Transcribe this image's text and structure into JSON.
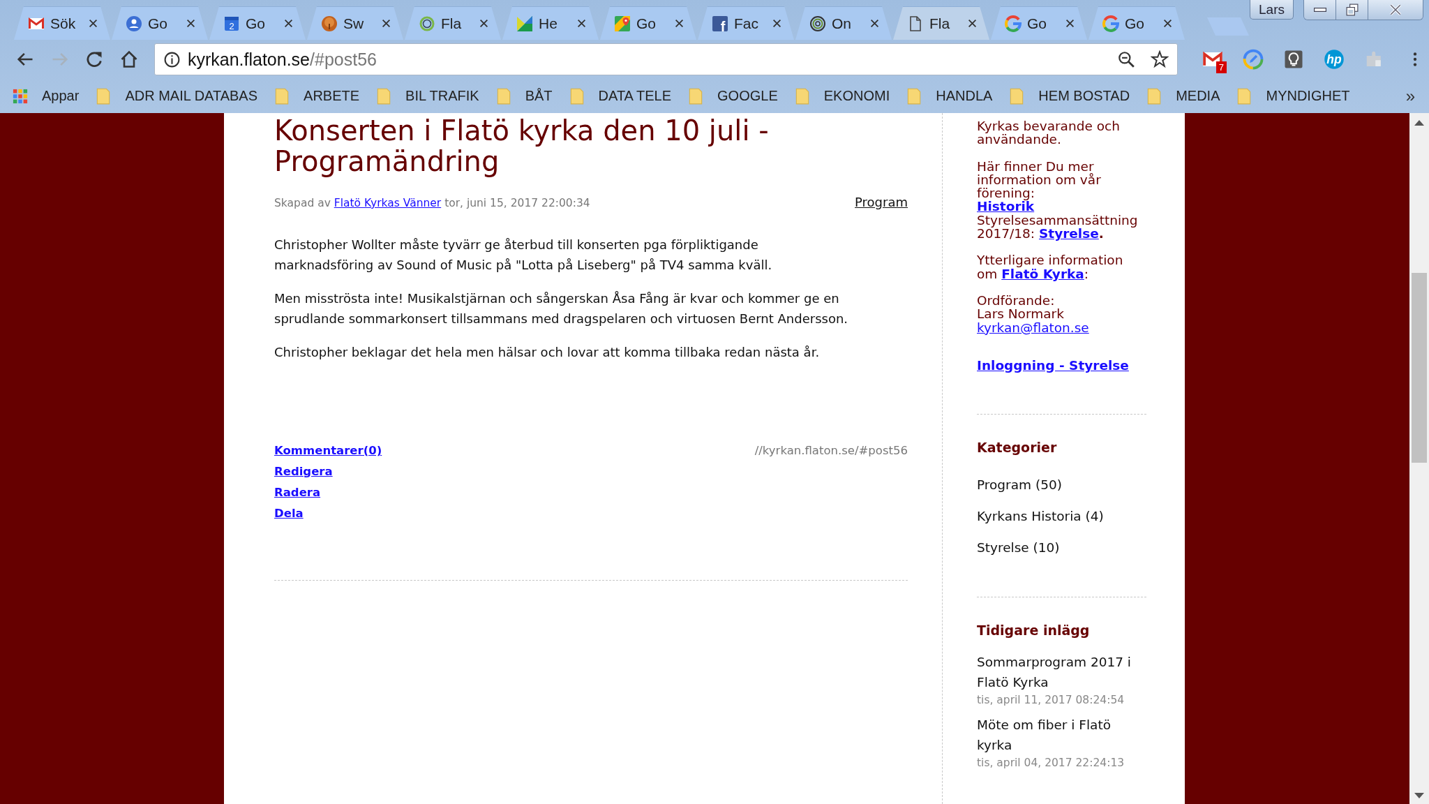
{
  "browser": {
    "tabs": [
      {
        "title": "Sök",
        "kind": "gmail",
        "selected": false
      },
      {
        "title": "Go",
        "kind": "contacts",
        "selected": false
      },
      {
        "title": "Go",
        "kind": "calendar",
        "icon_text": "2",
        "selected": false
      },
      {
        "title": "Sw",
        "kind": "tree",
        "selected": false
      },
      {
        "title": "Fla",
        "kind": "ring",
        "selected": false
      },
      {
        "title": "He",
        "kind": "triangles",
        "selected": false
      },
      {
        "title": "Go",
        "kind": "maps",
        "selected": false
      },
      {
        "title": "Fac",
        "kind": "facebook",
        "icon_text": "f",
        "selected": false
      },
      {
        "title": "On",
        "kind": "ringdark",
        "selected": false
      },
      {
        "title": "Fla",
        "kind": "page",
        "selected": true
      },
      {
        "title": "Go",
        "kind": "google",
        "selected": false
      },
      {
        "title": "Go",
        "kind": "google",
        "selected": false
      }
    ],
    "profile": "Lars",
    "nav": [
      {
        "kind": "back",
        "disabled": false
      },
      {
        "kind": "forward",
        "disabled": true
      },
      {
        "kind": "reload",
        "disabled": false
      },
      {
        "kind": "home",
        "disabled": false
      }
    ],
    "address": {
      "host": "kyrkan.flaton.se",
      "path": "/#post56"
    },
    "extensions": [
      {
        "kind": "gmail",
        "badge": "7"
      },
      {
        "kind": "pen"
      },
      {
        "kind": "bulb"
      },
      {
        "kind": "hp",
        "text": "hp"
      },
      {
        "kind": "puzzle"
      }
    ],
    "bookmarks": {
      "apps": "Appar",
      "folders": [
        "ADR MAIL DATABAS",
        "ARBETE",
        "BIL TRAFIK",
        "BÅT",
        "DATA TELE",
        "GOOGLE",
        "EKONOMI",
        "HANDLA",
        "HEM BOSTAD",
        "MEDIA",
        "MYNDIGHET"
      ],
      "more": "»"
    }
  },
  "post": {
    "title": "Konserten i Flatö kyrka den 10 juli - Programändring",
    "meta": {
      "prefix": "Skapad av",
      "author": "Flatö Kyrkas Vänner",
      "date": "tor, juni 15, 2017 22:00:34",
      "category": "Program"
    },
    "paragraphs": [
      [
        "Christopher Wollter måste tyvärr ge återbud till konserten pga förpliktigande",
        "marknadsföring av Sound of Music på \"Lotta på Liseberg\" på TV4 samma kväll."
      ],
      [
        "Men misströsta inte! Musikalstjärnan och sångerskan Åsa Fång är kvar och kommer ge en",
        "sprudlande sommarkonsert tillsammans med dragspelaren och virtuosen Bernt Andersson."
      ],
      [
        "Christopher beklagar det hela men hälsar och lovar att komma tillbaka redan nästa år."
      ]
    ],
    "actions": [
      "Kommentarer(0)",
      "Redigera",
      "Radera",
      "Dela"
    ],
    "permalink": "//kyrkan.flaton.se/#post56"
  },
  "sidebar": {
    "about": [
      {
        "lines": [
          [
            {
              "kind": "text",
              "text": "Kyrkas bevarande och"
            }
          ],
          [
            {
              "kind": "text",
              "text": "användande."
            }
          ]
        ]
      },
      {
        "lines": [
          [
            {
              "kind": "text",
              "text": "Här finner Du mer"
            }
          ],
          [
            {
              "kind": "text",
              "text": "information om vår"
            }
          ],
          [
            {
              "kind": "text",
              "text": "förening:"
            }
          ],
          [
            {
              "kind": "strong_link",
              "text": "Historik"
            }
          ],
          [
            {
              "kind": "text",
              "text": "Styrelsesammansättning"
            }
          ],
          [
            {
              "kind": "text",
              "text": "2017/18: "
            },
            {
              "kind": "strong_link",
              "text": "Styrelse"
            },
            {
              "kind": "strong",
              "text": "."
            }
          ]
        ]
      },
      {
        "lines": [
          [
            {
              "kind": "text",
              "text": "Ytterligare information"
            }
          ],
          [
            {
              "kind": "text",
              "text": "om "
            },
            {
              "kind": "strong_link",
              "text": "Flatö Kyrka"
            },
            {
              "kind": "text",
              "text": ":"
            }
          ]
        ]
      },
      {
        "lines": [
          [
            {
              "kind": "text",
              "text": "Ordförande:"
            }
          ],
          [
            {
              "kind": "text",
              "text": "Lars Normark"
            }
          ],
          [
            {
              "kind": "link",
              "text": "kyrkan@flaton.se"
            }
          ]
        ]
      }
    ],
    "login": "Inloggning - Styrelse",
    "categories": {
      "title": "Kategorier",
      "items": [
        "Program (50)",
        "Kyrkans Historia (4)",
        "Styrelse (10)"
      ]
    },
    "recent": {
      "title": "Tidigare inlägg",
      "items": [
        {
          "title": "Sommarprogram 2017 i Flatö Kyrka",
          "date": "tis, april 11, 2017 08:24:54"
        },
        {
          "title": "Möte om fiber i Flatö kyrka",
          "date": "tis, april 04, 2017 22:24:13"
        }
      ]
    }
  }
}
